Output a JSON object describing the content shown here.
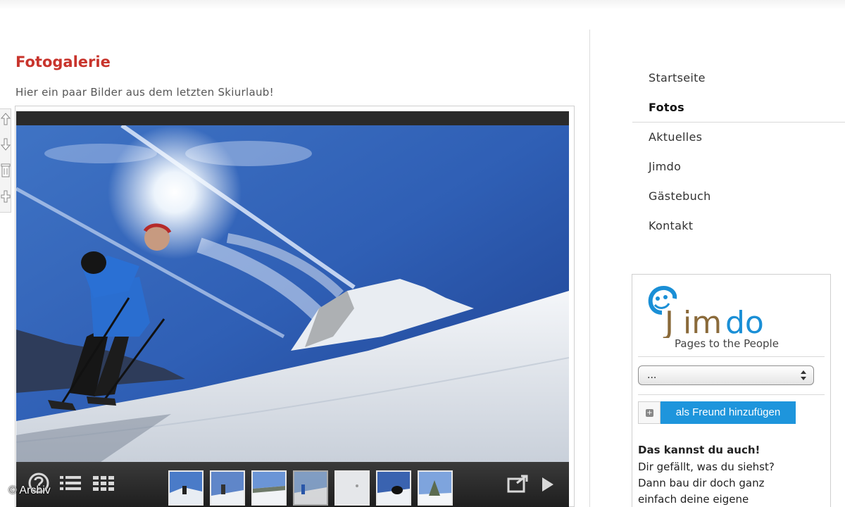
{
  "main": {
    "title": "Fotogalerie",
    "subtitle": "Hier ein paar Bilder aus dem letzten Skiurlaub!"
  },
  "gallery": {
    "photo_icon": "skier-on-snowy-mountain-photo",
    "thumbnail_count": 7,
    "active_thumbnail": 4,
    "controls": [
      "help-icon",
      "list-view-icon",
      "grid-view-icon",
      "fullscreen-icon",
      "play-icon"
    ]
  },
  "edit_tools": [
    "move-up-icon",
    "move-down-icon",
    "delete-icon",
    "add-icon"
  ],
  "copyright": "© Archiv",
  "nav": {
    "items": [
      {
        "label": "Startseite"
      },
      {
        "label": "Fotos",
        "active": true
      },
      {
        "label": "Aktuelles"
      },
      {
        "label": "Jimdo"
      },
      {
        "label": "Gästebuch"
      },
      {
        "label": "Kontakt"
      }
    ]
  },
  "widget": {
    "logo_text": "Jimdo",
    "slogan": "Pages to the People",
    "select_value": "...",
    "friend_button": "als Freund hinzufügen",
    "promo_heading": "Das kannst du auch!",
    "promo_line1": "Dir gefällt, was du siehst?",
    "promo_line2": "Dann bau dir doch ganz",
    "promo_line3": "einfach deine eigene"
  },
  "colors": {
    "title": "#c8342c",
    "accent_button": "#1e95dc",
    "logo_blue": "#1a8fd6",
    "logo_brown": "#8a6a3a"
  }
}
